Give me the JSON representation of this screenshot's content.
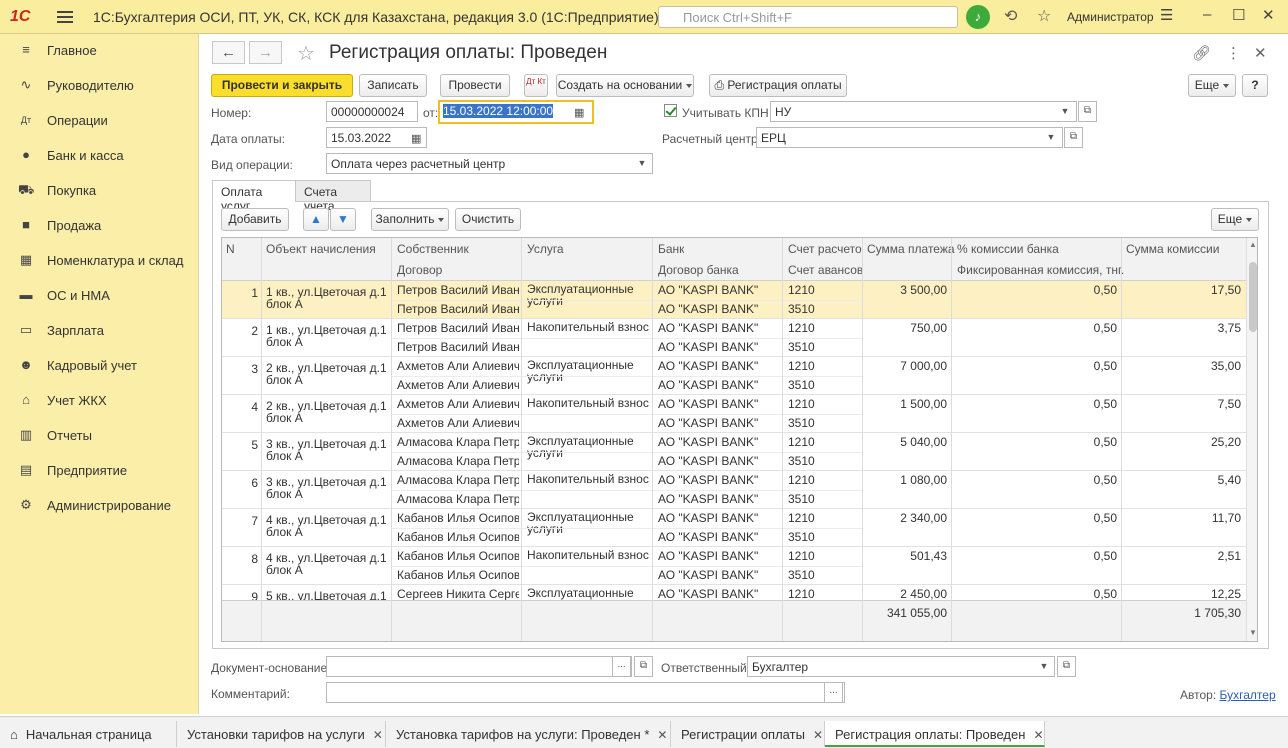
{
  "app": {
    "logo": "1С",
    "title": "1С:Бухгалтерия ОСИ, ПТ, УК, СК, КСК для Казахстана, редакция 3.0  (1С:Предприятие)",
    "search_placeholder": "Поиск Ctrl+Shift+F",
    "user": "Администратор"
  },
  "sidebar": {
    "items": [
      {
        "label": "Главное",
        "icon": "menu-icon"
      },
      {
        "label": "Руководителю",
        "icon": "chart-line-icon"
      },
      {
        "label": "Операции",
        "icon": "dt-kt-icon"
      },
      {
        "label": "Банк и касса",
        "icon": "money-bag-icon"
      },
      {
        "label": "Покупка",
        "icon": "cart-icon"
      },
      {
        "label": "Продажа",
        "icon": "shopping-bag-icon"
      },
      {
        "label": "Номенклатура и склад",
        "icon": "grid-icon"
      },
      {
        "label": "ОС и НМА",
        "icon": "truck-icon"
      },
      {
        "label": "Зарплата",
        "icon": "wallet-icon"
      },
      {
        "label": "Кадровый учет",
        "icon": "people-icon"
      },
      {
        "label": "Учет ЖКХ",
        "icon": "house-icon"
      },
      {
        "label": "Отчеты",
        "icon": "bar-chart-icon"
      },
      {
        "label": "Предприятие",
        "icon": "building-icon"
      },
      {
        "label": "Администрирование",
        "icon": "gear-icon"
      }
    ]
  },
  "form": {
    "title": "Регистрация оплаты: Проведен",
    "toolbar": {
      "post_close": "Провести и закрыть",
      "save": "Записать",
      "post": "Провести",
      "dtkt": "Дт Кт",
      "create_based": "Создать на основании",
      "print_registration": "Регистрация оплаты",
      "more": "Еще",
      "help": "?"
    },
    "number_label": "Номер:",
    "number": "00000000024",
    "from_label": "от:",
    "date": "15.03.2022 12:00:00",
    "kpn_label": "Учитывать КПН",
    "kpn_value": "НУ",
    "pay_date_label": "Дата оплаты:",
    "pay_date": "15.03.2022",
    "center_label": "Расчетный центр:",
    "center_value": "ЕРЦ",
    "op_type_label": "Вид операции:",
    "op_type": "Оплата через расчетный центр"
  },
  "tabs": [
    {
      "label": "Оплата услуг"
    },
    {
      "label": "Счета учета"
    }
  ],
  "grid_toolbar": {
    "add": "Добавить",
    "fill": "Заполнить",
    "clear": "Очистить",
    "more": "Еще"
  },
  "table": {
    "headers": {
      "n": "N",
      "object": "Объект начисления",
      "owner": "Собственник",
      "contract": "Договор",
      "service": "Услуга",
      "bank": "Банк",
      "bank_contract": "Договор банка",
      "account": "Счет расчето...",
      "advance_account": "Счет авансов",
      "sum": "Сумма платежа",
      "commission_pct": "% комиссии банка",
      "fixed_commission": "Фиксированная комиссия, тнг.",
      "commission_sum": "Сумма комиссии"
    },
    "rows": [
      {
        "n": "1",
        "object": "1 кв., ул.Цветочая д.1 блок А",
        "owner": "Петров Василий Иван...",
        "contract": "Петров Василий Иван...",
        "service": "Эксплуатационные услуги",
        "bank": "АО \"KASPI BANK\"",
        "bank_contract": "АО \"KASPI BANK\"",
        "account": "1210",
        "advance": "3510",
        "sum": "3 500,00",
        "pct": "0,50",
        "commission": "17,50"
      },
      {
        "n": "2",
        "object": "1 кв., ул.Цветочая д.1 блок А",
        "owner": "Петров Василий Иван...",
        "contract": "Петров Василий Иван...",
        "service": "Накопительный взнос",
        "bank": "АО \"KASPI BANK\"",
        "bank_contract": "АО \"KASPI BANK\"",
        "account": "1210",
        "advance": "3510",
        "sum": "750,00",
        "pct": "0,50",
        "commission": "3,75"
      },
      {
        "n": "3",
        "object": "2 кв., ул.Цветочая д.1 блок А",
        "owner": "Ахметов Али Алиевич",
        "contract": "Ахметов Али Алиевич",
        "service": "Эксплуатационные услуги",
        "bank": "АО \"KASPI BANK\"",
        "bank_contract": "АО \"KASPI BANK\"",
        "account": "1210",
        "advance": "3510",
        "sum": "7 000,00",
        "pct": "0,50",
        "commission": "35,00"
      },
      {
        "n": "4",
        "object": "2 кв., ул.Цветочая д.1 блок А",
        "owner": "Ахметов Али Алиевич",
        "contract": "Ахметов Али Алиевич",
        "service": "Накопительный взнос",
        "bank": "АО \"KASPI BANK\"",
        "bank_contract": "АО \"KASPI BANK\"",
        "account": "1210",
        "advance": "3510",
        "sum": "1 500,00",
        "pct": "0,50",
        "commission": "7,50"
      },
      {
        "n": "5",
        "object": "3 кв., ул.Цветочая д.1 блок А",
        "owner": "Алмасова Клара Петр...",
        "contract": "Алмасова Клара Петр...",
        "service": "Эксплуатационные услуги",
        "bank": "АО \"KASPI BANK\"",
        "bank_contract": "АО \"KASPI BANK\"",
        "account": "1210",
        "advance": "3510",
        "sum": "5 040,00",
        "pct": "0,50",
        "commission": "25,20"
      },
      {
        "n": "6",
        "object": "3 кв., ул.Цветочая д.1 блок А",
        "owner": "Алмасова Клара Петр...",
        "contract": "Алмасова Клара Петр...",
        "service": "Накопительный взнос",
        "bank": "АО \"KASPI BANK\"",
        "bank_contract": "АО \"KASPI BANK\"",
        "account": "1210",
        "advance": "3510",
        "sum": "1 080,00",
        "pct": "0,50",
        "commission": "5,40"
      },
      {
        "n": "7",
        "object": "4 кв., ул.Цветочая д.1 блок А",
        "owner": "Кабанов Илья Осипов...",
        "contract": "Кабанов Илья Осипов...",
        "service": "Эксплуатационные услуги",
        "bank": "АО \"KASPI BANK\"",
        "bank_contract": "АО \"KASPI BANK\"",
        "account": "1210",
        "advance": "3510",
        "sum": "2 340,00",
        "pct": "0,50",
        "commission": "11,70"
      },
      {
        "n": "8",
        "object": "4 кв., ул.Цветочая д.1 блок А",
        "owner": "Кабанов Илья Осипов...",
        "contract": "Кабанов Илья Осипов...",
        "service": "Накопительный взнос",
        "bank": "АО \"KASPI BANK\"",
        "bank_contract": "АО \"KASPI BANK\"",
        "account": "1210",
        "advance": "3510",
        "sum": "501,43",
        "pct": "0,50",
        "commission": "2,51"
      },
      {
        "n": "9",
        "object": "5 кв., ул.Цветочая д.1",
        "owner": "Сергеев Никита Серге...",
        "contract": "",
        "service": "Эксплуатационные",
        "bank": "АО \"KASPI BANK\"",
        "bank_contract": "",
        "account": "1210",
        "advance": "",
        "sum": "2 450,00",
        "pct": "0,50",
        "commission": "12,25"
      }
    ],
    "totals": {
      "sum": "341 055,00",
      "commission": "1 705,30"
    }
  },
  "bottom": {
    "basis_label": "Документ-основание:",
    "basis_value": "",
    "responsible_label": "Ответственный:",
    "responsible_value": "Бухгалтер",
    "comment_label": "Комментарий:",
    "comment_value": "",
    "author_label": "Автор:",
    "author_value": "Бухгалтер"
  },
  "taskbar": {
    "home": "Начальная страница",
    "tasks": [
      {
        "label": "Установки тарифов на услуги",
        "closable": true
      },
      {
        "label": "Установка тарифов на услуги: Проведен *",
        "closable": true
      },
      {
        "label": "Регистрации оплаты",
        "closable": true
      },
      {
        "label": "Регистрация оплаты: Проведен",
        "closable": true
      }
    ]
  },
  "colors": {
    "accent": "#fbdd2b",
    "topbar": "#fbed9e",
    "sidebar": "#fbeea8",
    "selected_row": "#fdf0c2",
    "active_tab_underline": "#3aa83a"
  }
}
